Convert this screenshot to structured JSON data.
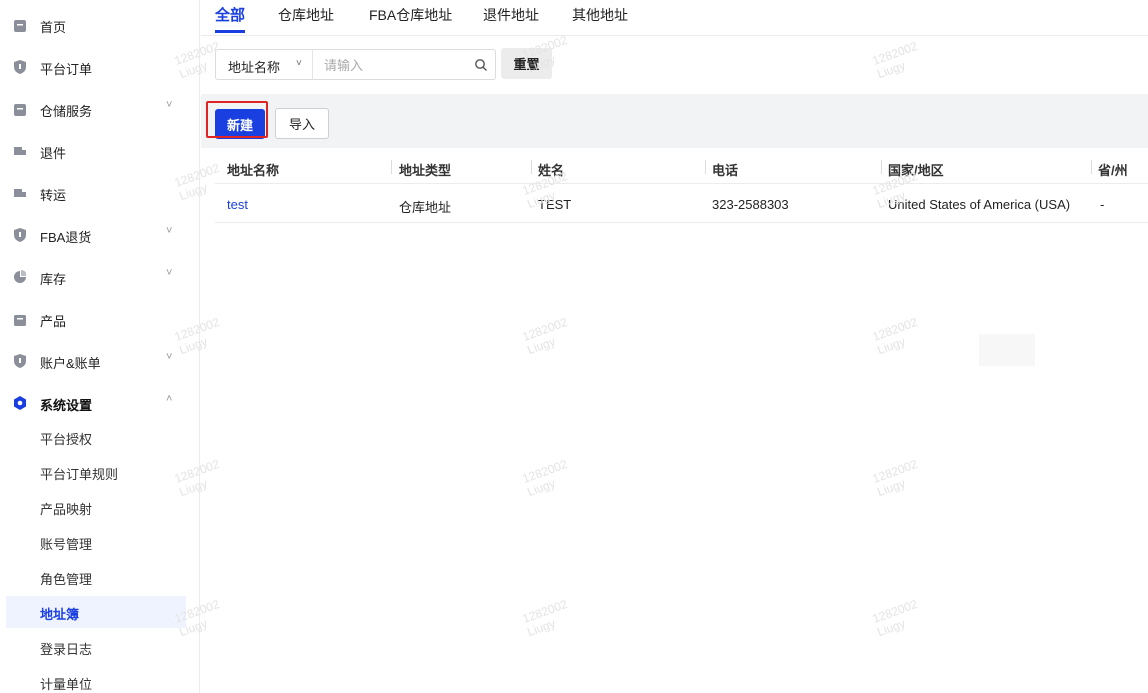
{
  "sidebar": {
    "items": [
      {
        "label": "首页",
        "icon": "home-icon"
      },
      {
        "label": "平台订单",
        "icon": "shield-icon"
      },
      {
        "label": "仓储服务",
        "icon": "home-icon",
        "chevron": "˅"
      },
      {
        "label": "退件",
        "icon": "truck-icon"
      },
      {
        "label": "转运",
        "icon": "truck-icon"
      },
      {
        "label": "FBA退货",
        "icon": "shield-icon",
        "chevron": "˅"
      },
      {
        "label": "库存",
        "icon": "pie-chart-icon",
        "chevron": "˅"
      },
      {
        "label": "产品",
        "icon": "bag-icon"
      },
      {
        "label": "账户&账单",
        "icon": "shield-icon",
        "chevron": "˅"
      },
      {
        "label": "系统设置",
        "icon": "hexagon-icon",
        "chevron": "˄"
      }
    ],
    "subitems": [
      {
        "label": "平台授权"
      },
      {
        "label": "平台订单规则"
      },
      {
        "label": "产品映射"
      },
      {
        "label": "账号管理"
      },
      {
        "label": "角色管理"
      },
      {
        "label": "地址簿"
      },
      {
        "label": "登录日志"
      },
      {
        "label": "计量单位"
      }
    ]
  },
  "tabs": [
    {
      "label": "全部"
    },
    {
      "label": "仓库地址"
    },
    {
      "label": "FBA仓库地址"
    },
    {
      "label": "退件地址"
    },
    {
      "label": "其他地址"
    }
  ],
  "filter": {
    "field_label": "地址名称",
    "placeholder": "请输入",
    "reset_label": "重置"
  },
  "toolbar": {
    "new_label": "新建",
    "import_label": "导入"
  },
  "table": {
    "headers": [
      "地址名称",
      "地址类型",
      "姓名",
      "电话",
      "国家/地区",
      "省/州"
    ],
    "rows": [
      [
        "test",
        "仓库地址",
        "TEST",
        "323-2588303",
        "United States of America (USA)",
        "-"
      ]
    ]
  },
  "watermark": {
    "line1": "1282002",
    "line2": "Liugy"
  },
  "colors": {
    "accent": "#1a3fe0",
    "highlight": "#e02424",
    "band": "#f2f3f5"
  }
}
